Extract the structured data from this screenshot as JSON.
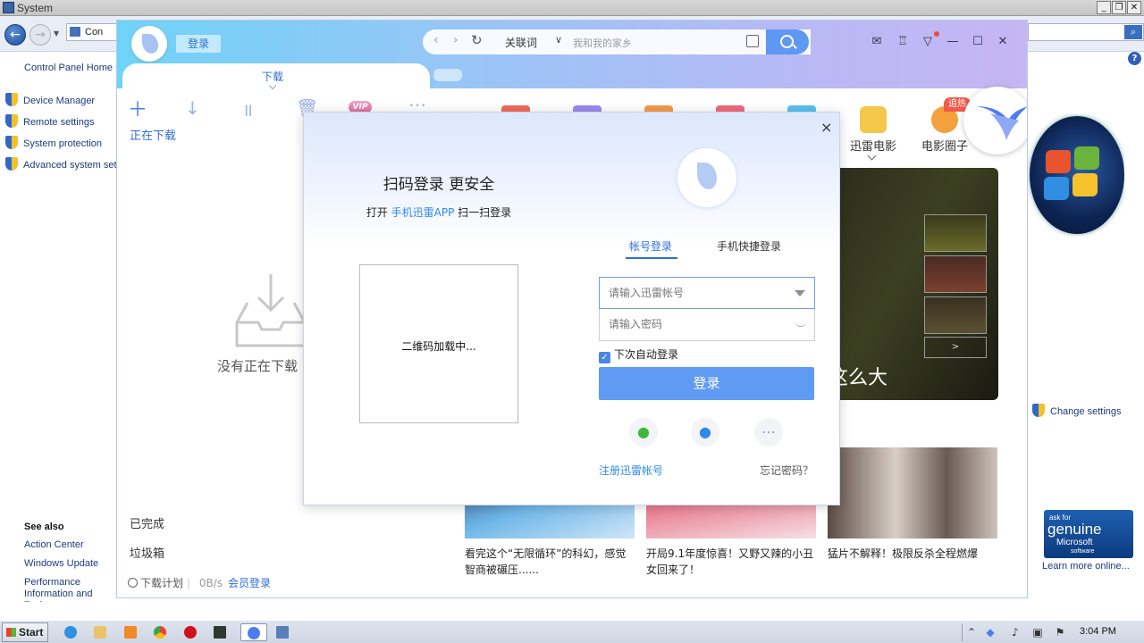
{
  "system_window": {
    "title": "System",
    "address_text": "Con",
    "left_pane": {
      "home": "Control Panel Home",
      "links": [
        "Device Manager",
        "Remote settings",
        "System protection",
        "Advanced system settings"
      ]
    },
    "see_also": {
      "heading": "See also",
      "links": [
        "Action Center",
        "Windows Update",
        "Performance Information and Tools"
      ]
    },
    "change_settings": "Change settings",
    "genuine": {
      "line1": "ask for",
      "line2": "genuine",
      "line3": "Microsoft",
      "line4": "software"
    },
    "learn_more": "Learn more online..."
  },
  "xunlei": {
    "login_button": "登录",
    "search": {
      "keyword_label": "关联词",
      "placeholder": "我和我的家乡"
    },
    "tab_download": "下载",
    "toolbar": {
      "vip": "VIP"
    },
    "sidebar": {
      "downloading": "正在下载",
      "empty_message": "没有正在下载",
      "finished": "已完成",
      "trash": "垃圾箱"
    },
    "footer": {
      "schedule": "下载计划",
      "speed": "0B/s",
      "member_login": "会员登录"
    },
    "channels": [
      {
        "label": "迅雷电影",
        "color": "#f3c84a"
      },
      {
        "label": "电影圈子",
        "color": "#f2a13c",
        "badge": "追热"
      }
    ],
    "hero_title": "这么大",
    "hero_next": ">",
    "cards": [
      {
        "caption": "看完这个“无限循环”的科幻，感觉智商被碾压......"
      },
      {
        "caption": "开局9.1年度惊喜！又野又辣的小丑女回来了！"
      },
      {
        "caption": "猛片不解释！极限反杀全程燃爆"
      }
    ]
  },
  "login_dialog": {
    "close": "×",
    "qr_title": "扫码登录 更安全",
    "qr_hint_prefix": "打开 ",
    "qr_hint_app": "手机迅雷APP",
    "qr_hint_suffix": " 扫一扫登录",
    "qr_loading": "二维码加载中...",
    "tab_account": "帐号登录",
    "tab_phone": "手机快捷登录",
    "username_placeholder": "请输入迅雷帐号",
    "password_placeholder": "请输入密码",
    "auto_login": "下次自动登录",
    "submit": "登录",
    "register": "注册迅雷帐号",
    "forgot": "忘记密码？"
  },
  "taskbar": {
    "start": "Start",
    "clock": "3:04 PM"
  },
  "colors": {
    "accent": "#2e6fd6",
    "button": "#5f9af3",
    "link": "#2e8ae6"
  }
}
